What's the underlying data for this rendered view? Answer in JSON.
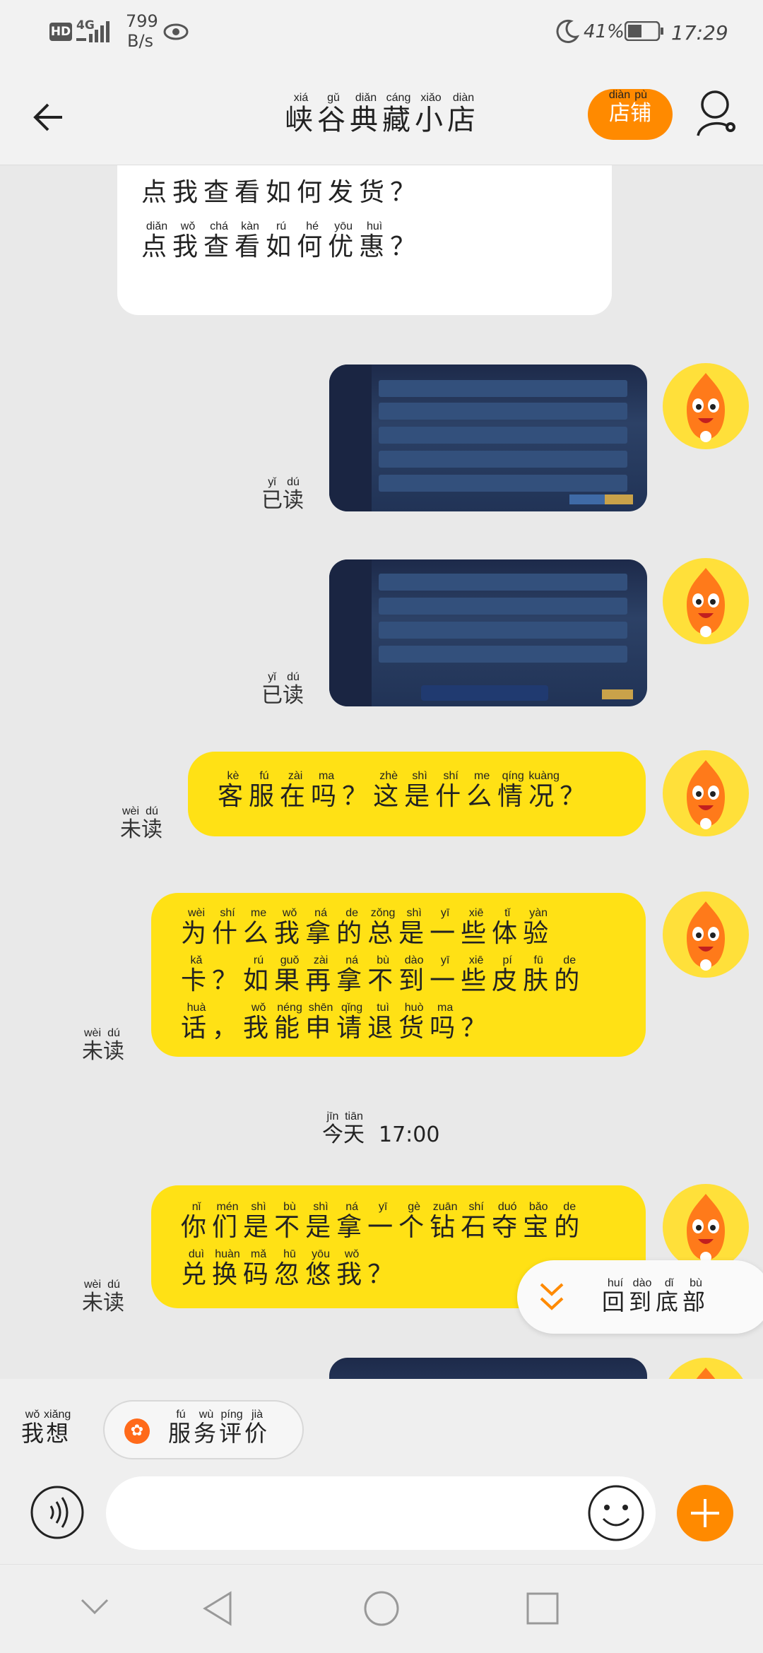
{
  "status": {
    "network": "HD",
    "sim": "4G",
    "speed": "799",
    "speed_unit": "B/s",
    "battery": "41%",
    "time": "17:29"
  },
  "header": {
    "title_chars": [
      [
        "峡",
        "xiá"
      ],
      [
        "谷",
        "gǔ"
      ],
      [
        "典",
        "diǎn"
      ],
      [
        "藏",
        "cáng"
      ],
      [
        "小",
        "xiǎo"
      ],
      [
        "店",
        "diàn"
      ]
    ],
    "shop_chars": [
      [
        "店",
        "diàn"
      ],
      [
        "铺",
        "pù"
      ]
    ]
  },
  "messages": {
    "menu_line1": "点我查看如何发货？",
    "menu_line2_chars": [
      [
        "点",
        "diǎn"
      ],
      [
        "我",
        "wǒ"
      ],
      [
        "查",
        "chá"
      ],
      [
        "看",
        "kàn"
      ],
      [
        "如",
        "rú"
      ],
      [
        "何",
        "hé"
      ],
      [
        "优",
        "yōu"
      ],
      [
        "惠",
        "huì"
      ],
      [
        "？",
        ""
      ]
    ],
    "read_chars": [
      [
        "已",
        "yǐ"
      ],
      [
        "读",
        "dú"
      ]
    ],
    "unread_chars": [
      [
        "未",
        "wèi"
      ],
      [
        "读",
        "dú"
      ]
    ],
    "q1_chars": [
      [
        "客",
        "kè"
      ],
      [
        "服",
        "fú"
      ],
      [
        "在",
        "zài"
      ],
      [
        "吗",
        "ma"
      ],
      [
        "？",
        ""
      ],
      [
        "这",
        "zhè"
      ],
      [
        "是",
        "shì"
      ],
      [
        "什",
        "shí"
      ],
      [
        "么",
        "me"
      ],
      [
        "情",
        "qíng"
      ],
      [
        "况",
        "kuàng"
      ],
      [
        "？",
        ""
      ]
    ],
    "q2_line1": [
      [
        "为",
        "wèi"
      ],
      [
        "什",
        "shí"
      ],
      [
        "么",
        "me"
      ],
      [
        "我",
        "wǒ"
      ],
      [
        "拿",
        "ná"
      ],
      [
        "的",
        "de"
      ],
      [
        "总",
        "zǒng"
      ],
      [
        "是",
        "shì"
      ],
      [
        "一",
        "yī"
      ],
      [
        "些",
        "xiē"
      ],
      [
        "体",
        "tǐ"
      ],
      [
        "验",
        "yàn"
      ]
    ],
    "q2_line2": [
      [
        "卡",
        "kǎ"
      ],
      [
        "？",
        ""
      ],
      [
        "如",
        "rú"
      ],
      [
        "果",
        "guǒ"
      ],
      [
        "再",
        "zài"
      ],
      [
        "拿",
        "ná"
      ],
      [
        "不",
        "bù"
      ],
      [
        "到",
        "dào"
      ],
      [
        "一",
        "yī"
      ],
      [
        "些",
        "xiē"
      ],
      [
        "皮",
        "pí"
      ],
      [
        "肤",
        "fū"
      ],
      [
        "的",
        "de"
      ]
    ],
    "q2_line3": [
      [
        "话",
        "huà"
      ],
      [
        "，",
        ""
      ],
      [
        "我",
        "wǒ"
      ],
      [
        "能",
        "néng"
      ],
      [
        "申",
        "shēn"
      ],
      [
        "请",
        "qǐng"
      ],
      [
        "退",
        "tuì"
      ],
      [
        "货",
        "huò"
      ],
      [
        "吗",
        "ma"
      ],
      [
        "？",
        ""
      ]
    ],
    "time_chars": [
      [
        "今",
        "jīn"
      ],
      [
        "天",
        "tiān"
      ]
    ],
    "time_value": "17:00",
    "q3_line1": [
      [
        "你",
        "nǐ"
      ],
      [
        "们",
        "mén"
      ],
      [
        "是",
        "shì"
      ],
      [
        "不",
        "bù"
      ],
      [
        "是",
        "shì"
      ],
      [
        "拿",
        "ná"
      ],
      [
        "一",
        "yī"
      ],
      [
        "个",
        "gè"
      ],
      [
        "钻",
        "zuān"
      ],
      [
        "石",
        "shí"
      ],
      [
        "夺",
        "duó"
      ],
      [
        "宝",
        "bǎo"
      ],
      [
        "的",
        "de"
      ]
    ],
    "q3_line2": [
      [
        "兑",
        "duì"
      ],
      [
        "换",
        "huàn"
      ],
      [
        "码",
        "mǎ"
      ],
      [
        "忽",
        "hū"
      ],
      [
        "悠",
        "yōu"
      ],
      [
        "我",
        "wǒ"
      ],
      [
        "？",
        ""
      ]
    ],
    "back_bottom_chars": [
      [
        "回",
        "huí"
      ],
      [
        "到",
        "dào"
      ],
      [
        "底",
        "dǐ"
      ],
      [
        "部",
        "bù"
      ]
    ]
  },
  "bottom": {
    "want_chars": [
      [
        "我",
        "wǒ"
      ],
      [
        "想",
        "xiǎng"
      ]
    ],
    "service_chars": [
      [
        "服",
        "fú"
      ],
      [
        "务",
        "wù"
      ],
      [
        "评",
        "píng"
      ],
      [
        "价",
        "jià"
      ]
    ],
    "input_placeholder": ""
  },
  "colors": {
    "accent": "#ff8a00",
    "bubble": "#ffe115"
  }
}
